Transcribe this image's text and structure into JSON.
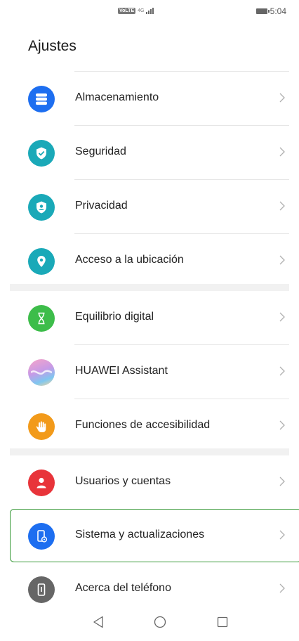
{
  "status_bar": {
    "network_badge": "VoLTE",
    "network_type": "4G",
    "time": "5:04"
  },
  "page": {
    "title": "Ajustes"
  },
  "settings_items": [
    {
      "label": "Almacenamiento",
      "icon": "storage-icon",
      "color": "#1d6ef0"
    },
    {
      "label": "Seguridad",
      "icon": "shield-check-icon",
      "color": "#1aa9b8"
    },
    {
      "label": "Privacidad",
      "icon": "privacy-shield-icon",
      "color": "#1aa9b8"
    },
    {
      "label": "Acceso a la ubicación",
      "icon": "location-pin-icon",
      "color": "#1aa9b8"
    },
    {
      "label": "Equilibrio digital",
      "icon": "hourglass-icon",
      "color": "#3dbd4a"
    },
    {
      "label": "HUAWEI Assistant",
      "icon": "huawei-assistant-icon",
      "color": "#c88ad8"
    },
    {
      "label": "Funciones de accesibilidad",
      "icon": "hand-icon",
      "color": "#f29a1a"
    },
    {
      "label": "Usuarios y cuentas",
      "icon": "user-icon",
      "color": "#e8343a"
    },
    {
      "label": "Sistema y actualizaciones",
      "icon": "phone-settings-icon",
      "color": "#1d6ef0"
    },
    {
      "label": "Acerca del teléfono",
      "icon": "phone-info-icon",
      "color": "#666666"
    }
  ],
  "highlighted_item": "Sistema y actualizaciones",
  "nav_bar": {
    "back": "back-icon",
    "home": "home-icon",
    "recents": "recents-icon"
  }
}
